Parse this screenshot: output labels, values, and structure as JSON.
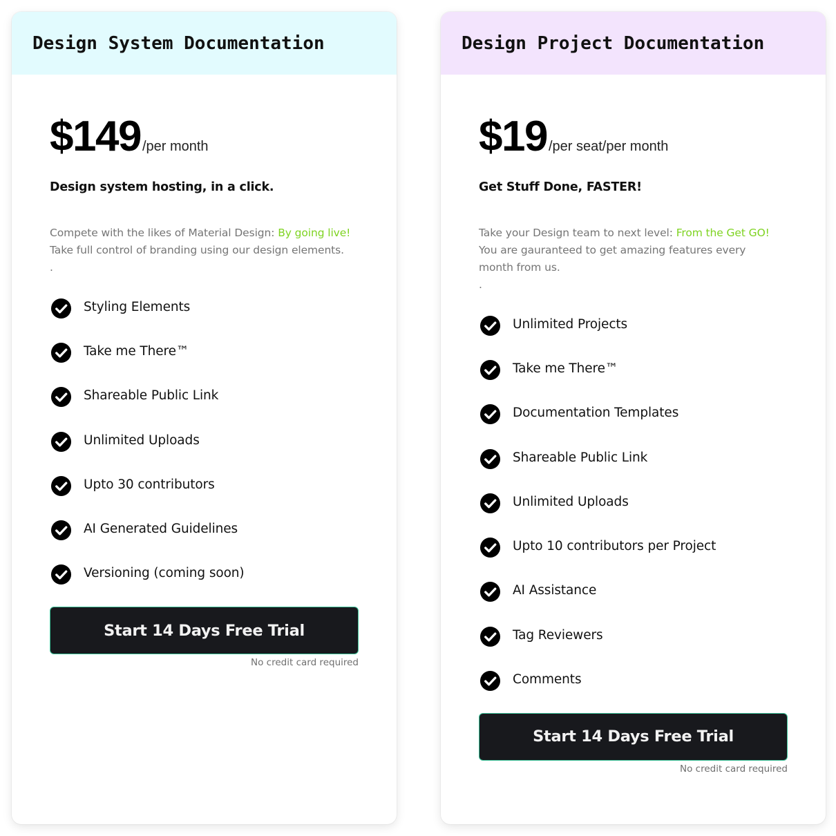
{
  "plans": [
    {
      "title": "Design System Documentation",
      "header_color": "#e2fbfe",
      "price": "$149",
      "price_unit": "/per month",
      "tagline": "Design system hosting, in a click.",
      "description": {
        "lead": "Compete with the likes of Material Design: ",
        "accent": "By going live!",
        "body": "Take full control of branding using our design elements.",
        "trailing": "."
      },
      "features": [
        "Styling Elements",
        "Take me There™",
        "Shareable Public Link",
        "Unlimited Uploads",
        "Upto 30 contributors",
        "AI Generated Guidelines",
        "Versioning (coming soon)"
      ],
      "cta_label": "Start 14 Days Free Trial",
      "cta_note": "No credit card required"
    },
    {
      "title": "Design Project Documentation",
      "header_color": "#f3e4fd",
      "price": "$19",
      "price_unit": "/per seat/per month",
      "tagline": "Get Stuff Done, FASTER!",
      "description": {
        "lead": "Take your Design team to next level: ",
        "accent": "From the Get GO!",
        "body": "You are gauranteed to get amazing features every month from us.",
        "trailing": "."
      },
      "features": [
        "Unlimited Projects",
        "Take me There™",
        "Documentation Templates",
        "Shareable Public Link",
        "Unlimited Uploads",
        "Upto 10 contributors per Project",
        "AI Assistance",
        "Tag Reviewers",
        "Comments"
      ],
      "cta_label": "Start 14 Days Free Trial",
      "cta_note": "No credit card required"
    }
  ],
  "colors": {
    "accent_green": "#7ed321",
    "button_bg": "#18191d",
    "button_border": "#3cc49a",
    "muted_text": "#757575"
  },
  "icons": {
    "feature_bullet": "check-circle-icon"
  }
}
